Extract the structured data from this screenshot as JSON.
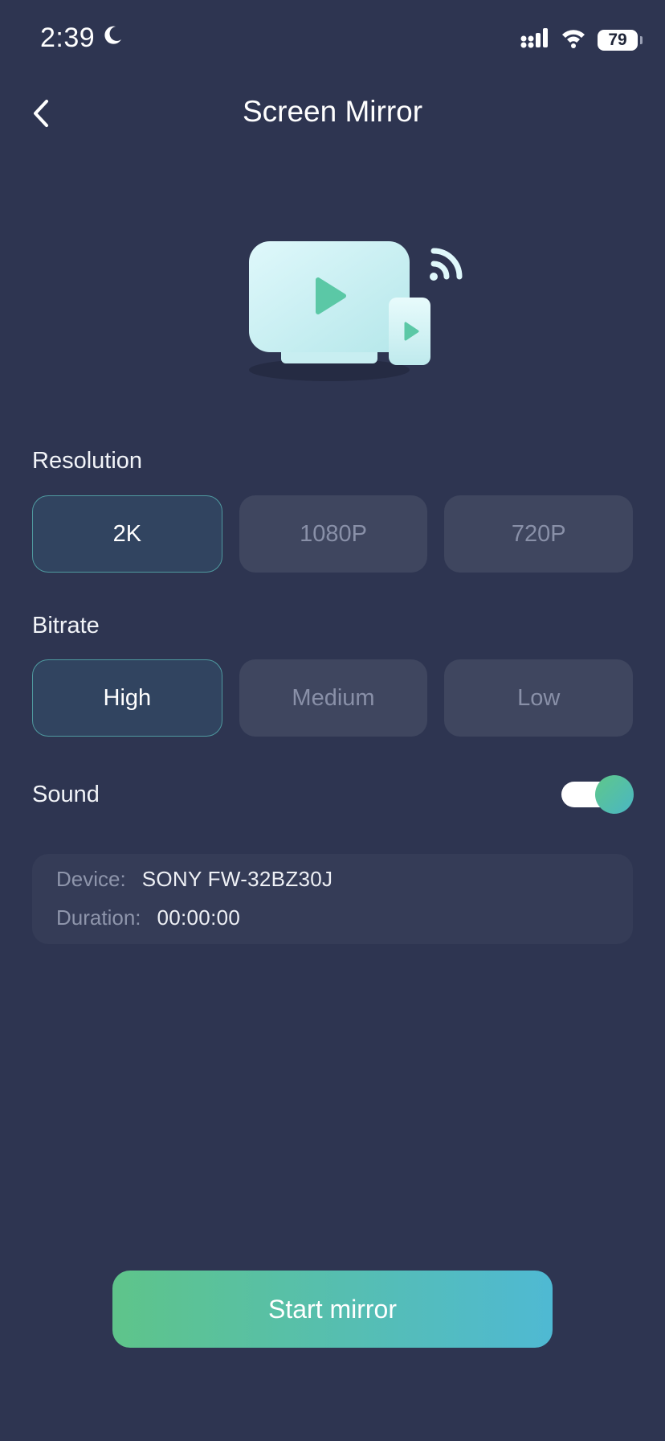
{
  "status_bar": {
    "time": "2:39",
    "battery": "79",
    "icons": [
      "moon-icon",
      "signal-icon",
      "wifi-icon",
      "battery-icon"
    ]
  },
  "header": {
    "title": "Screen Mirror",
    "back_icon": "chevron-left-icon"
  },
  "hero": {
    "icon": "tv-phone-cast-illustration"
  },
  "resolution": {
    "label": "Resolution",
    "options": [
      "2K",
      "1080P",
      "720P"
    ],
    "selected": "2K"
  },
  "bitrate": {
    "label": "Bitrate",
    "options": [
      "High",
      "Medium",
      "Low"
    ],
    "selected": "High"
  },
  "sound": {
    "label": "Sound",
    "enabled": true
  },
  "info": {
    "device_key": "Device:",
    "device_value": "SONY FW-32BZ30J",
    "duration_key": "Duration:",
    "duration_value": "00:00:00"
  },
  "start_button": {
    "label": "Start mirror"
  },
  "colors": {
    "background": "#2e3551",
    "accent_green": "#5ec48a",
    "accent_cyan": "#4fb9d3",
    "selected_border": "#4f9aa0"
  }
}
